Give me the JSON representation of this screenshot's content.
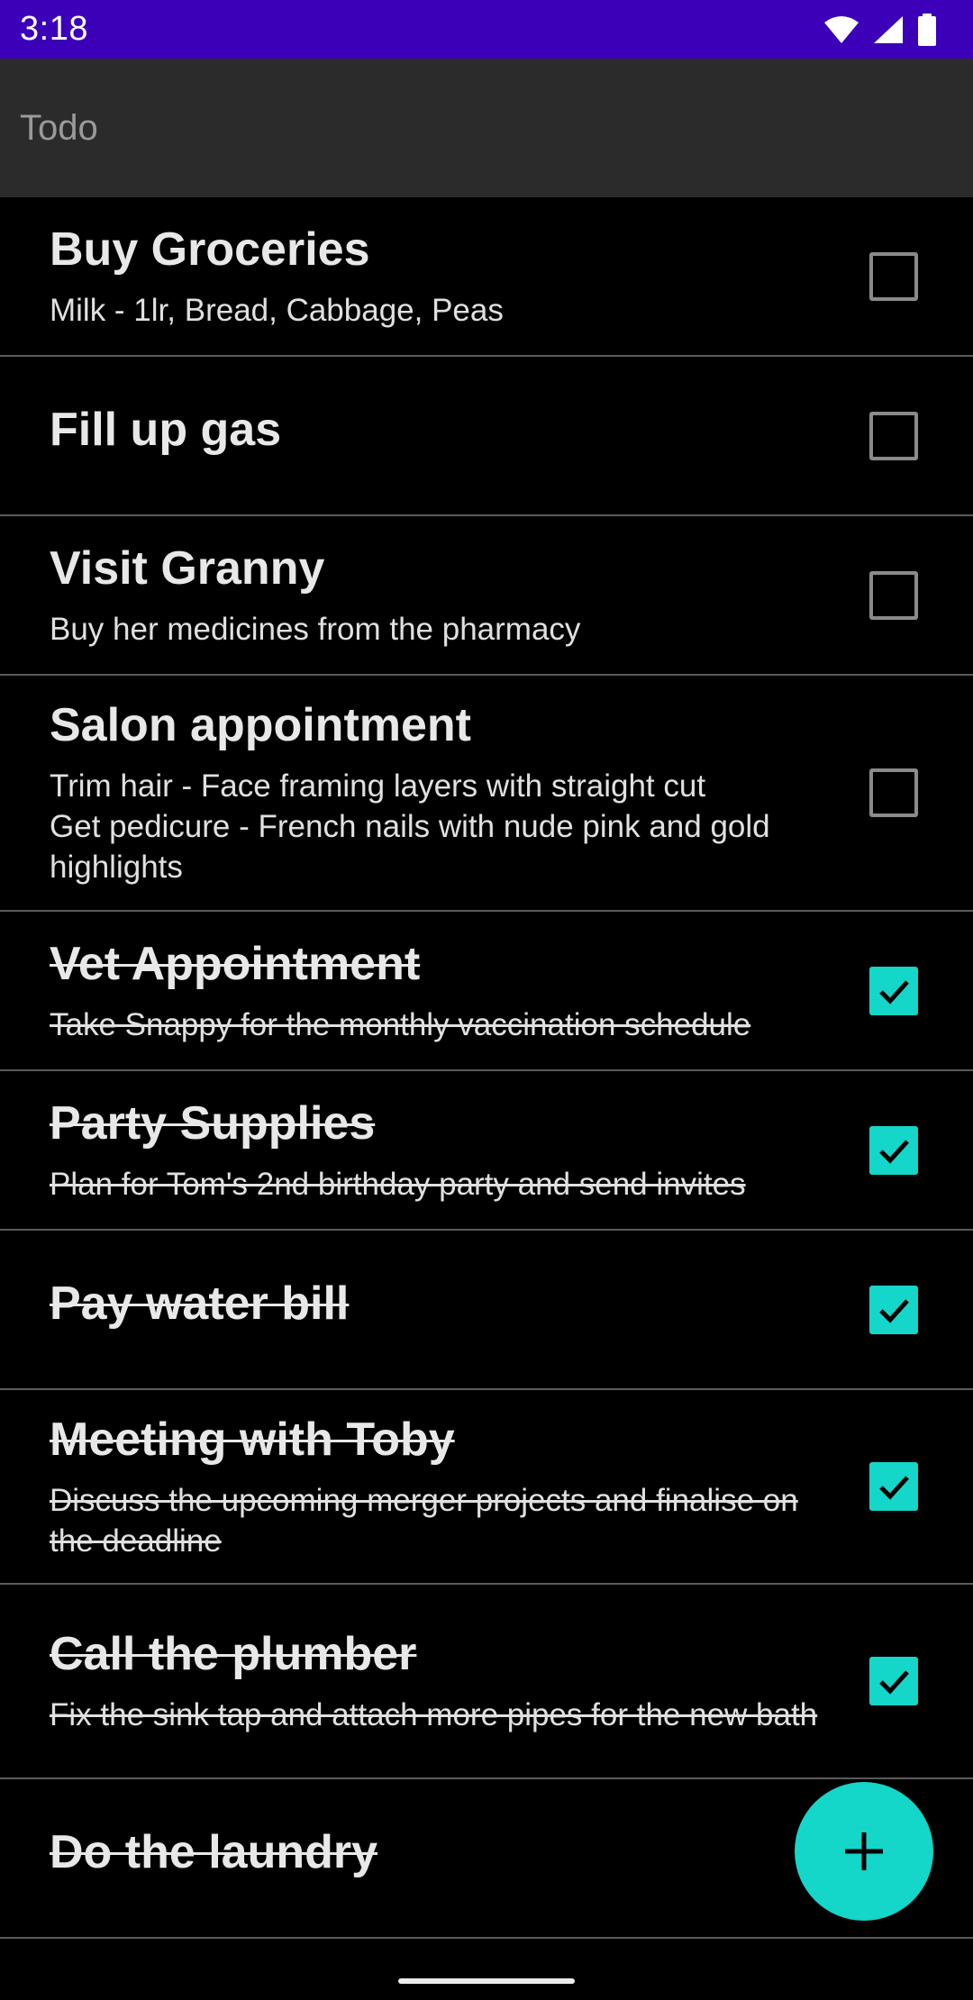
{
  "status_bar": {
    "time": "3:18",
    "icons": [
      "wifi-icon",
      "cellular-signal-icon",
      "battery-icon"
    ],
    "background": "#3b00b8"
  },
  "app_bar": {
    "title": "Todo",
    "background": "#2b2b2b"
  },
  "accent_color": "#14d6c9",
  "todos": [
    {
      "title": "Buy Groceries",
      "description": "Milk - 1lr, Bread, Cabbage, Peas",
      "completed": false
    },
    {
      "title": "Fill up gas",
      "description": "",
      "completed": false
    },
    {
      "title": "Visit Granny",
      "description": "Buy her medicines from the pharmacy",
      "completed": false
    },
    {
      "title": "Salon appointment",
      "description": "Trim hair - Face framing layers with straight cut\nGet pedicure - French nails with nude pink and gold highlights",
      "completed": false
    },
    {
      "title": "Vet Appointment",
      "description": "Take Snappy for the monthly vaccination schedule",
      "completed": true
    },
    {
      "title": "Party Supplies",
      "description": "Plan for Tom's 2nd birthday party and send invites",
      "completed": true
    },
    {
      "title": "Pay water bill",
      "description": "",
      "completed": true
    },
    {
      "title": "Meeting with Toby",
      "description": "Discuss the upcoming merger projects and finalise on the deadline",
      "completed": true
    },
    {
      "title": "Call the plumber",
      "description": "Fix the sink tap and attach more pipes for the new bath",
      "completed": true
    },
    {
      "title": "Do the laundry",
      "description": "",
      "completed": true
    }
  ],
  "fab": {
    "icon": "plus-icon"
  }
}
